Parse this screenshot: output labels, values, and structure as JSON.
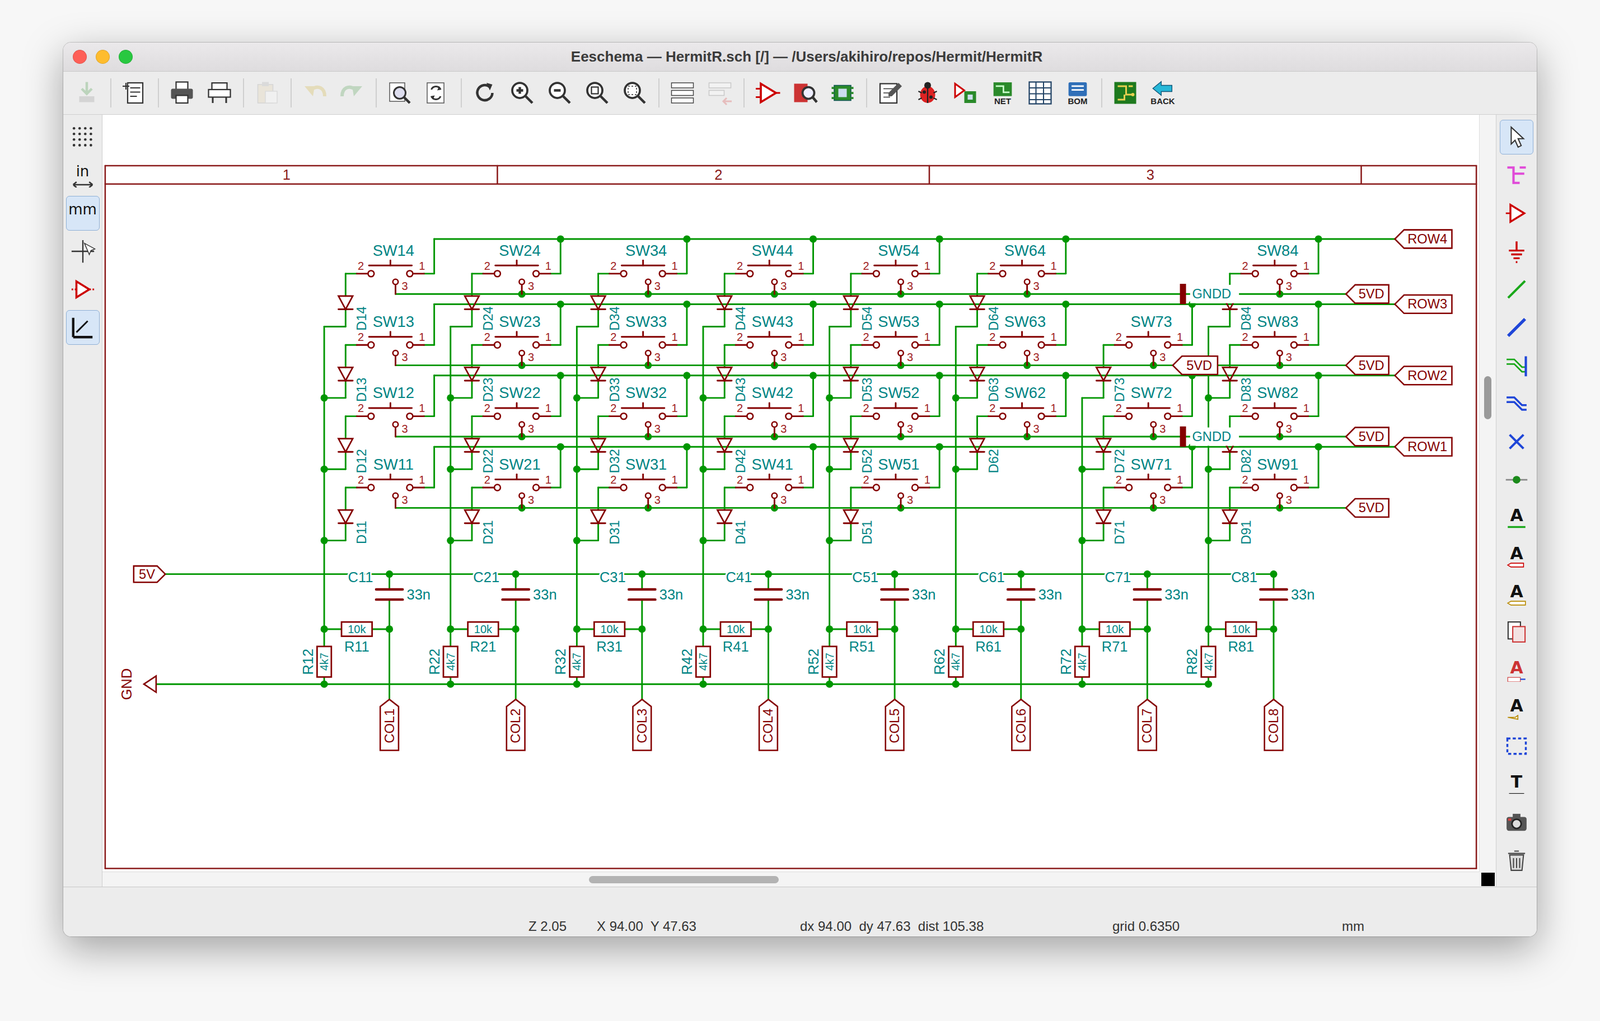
{
  "window": {
    "title": "Eeschema — HermitR.sch [/] — /Users/akihiro/repos/Hermit/HermitR"
  },
  "toolbar": [
    {
      "kind": "save",
      "disabled": true
    },
    {
      "kind": "sep",
      "disabled": false
    },
    {
      "kind": "page",
      "disabled": false
    },
    {
      "kind": "sep",
      "disabled": false
    },
    {
      "kind": "print",
      "disabled": false
    },
    {
      "kind": "plot",
      "disabled": false
    },
    {
      "kind": "sep",
      "disabled": false
    },
    {
      "kind": "paste",
      "disabled": true
    },
    {
      "kind": "sep",
      "disabled": false
    },
    {
      "kind": "undo",
      "disabled": true
    },
    {
      "kind": "redo",
      "disabled": true
    },
    {
      "kind": "sep",
      "disabled": false
    },
    {
      "kind": "find",
      "disabled": false
    },
    {
      "kind": "replace",
      "disabled": false
    },
    {
      "kind": "sep",
      "disabled": false
    },
    {
      "kind": "refresh",
      "disabled": false
    },
    {
      "kind": "zoomin",
      "disabled": false
    },
    {
      "kind": "zoomout",
      "disabled": false
    },
    {
      "kind": "zoomfit",
      "disabled": false
    },
    {
      "kind": "zoomsel",
      "disabled": false
    },
    {
      "kind": "sep",
      "disabled": false
    },
    {
      "kind": "hierarchy",
      "disabled": false
    },
    {
      "kind": "leave",
      "disabled": true
    },
    {
      "kind": "sep",
      "disabled": false
    },
    {
      "kind": "symedit",
      "disabled": false
    },
    {
      "kind": "library",
      "disabled": false
    },
    {
      "kind": "fpedit",
      "disabled": false
    },
    {
      "kind": "sep",
      "disabled": false
    },
    {
      "kind": "annotate",
      "disabled": false
    },
    {
      "kind": "erc",
      "disabled": false
    },
    {
      "kind": "assign",
      "disabled": false
    },
    {
      "kind": "netlist",
      "label": "NET",
      "disabled": false
    },
    {
      "kind": "fields",
      "disabled": false
    },
    {
      "kind": "bom",
      "label": "BOM",
      "disabled": false
    },
    {
      "kind": "sep",
      "disabled": false
    },
    {
      "kind": "pcb",
      "disabled": false
    },
    {
      "kind": "back",
      "label": "BACK",
      "disabled": false
    }
  ],
  "left_toolbar": [
    {
      "kind": "grid",
      "selected": false
    },
    {
      "kind": "inch",
      "label": "in",
      "selected": false
    },
    {
      "kind": "mm",
      "label": "mm",
      "selected": true
    },
    {
      "kind": "cursor",
      "selected": false
    },
    {
      "kind": "pins",
      "selected": false
    },
    {
      "kind": "angle",
      "selected": true
    }
  ],
  "right_toolbar": [
    {
      "kind": "select",
      "selected": true
    },
    {
      "kind": "hiernav",
      "selected": false
    },
    {
      "kind": "symbol",
      "selected": false
    },
    {
      "kind": "power",
      "selected": false
    },
    {
      "kind": "wire",
      "selected": false
    },
    {
      "kind": "bus",
      "selected": false
    },
    {
      "kind": "wireentry",
      "selected": false
    },
    {
      "kind": "busentry",
      "selected": false
    },
    {
      "kind": "noconnect",
      "selected": false
    },
    {
      "kind": "junction",
      "selected": false
    },
    {
      "kind": "label",
      "glyph": "A",
      "selected": false
    },
    {
      "kind": "globallabel",
      "glyph": "A",
      "selected": false
    },
    {
      "kind": "hierlabel",
      "glyph": "A",
      "selected": false
    },
    {
      "kind": "sheet",
      "selected": false
    },
    {
      "kind": "importpin",
      "glyph": "A",
      "selected": false
    },
    {
      "kind": "sheetpin",
      "glyph": "A",
      "selected": false
    },
    {
      "kind": "rect",
      "selected": false
    },
    {
      "kind": "text",
      "glyph": "T",
      "selected": false
    },
    {
      "kind": "image",
      "selected": false
    },
    {
      "kind": "delete",
      "selected": false
    }
  ],
  "sheet": {
    "zones": [
      "1",
      "2",
      "3"
    ]
  },
  "schematic": {
    "power_in": "5V",
    "ground": "GND",
    "pin_numbers": {
      "left": "2",
      "right": "1",
      "common": "3"
    },
    "rows": [
      {
        "label": "ROW4",
        "supply": "5VD",
        "mid": {
          "kind": "ground",
          "text": "GNDD"
        }
      },
      {
        "label": "ROW3",
        "supply": "5VD",
        "mid": {
          "kind": "net",
          "text": "5VD"
        }
      },
      {
        "label": "ROW2",
        "supply": "5VD",
        "mid": {
          "kind": "ground",
          "text": "GNDD"
        }
      },
      {
        "label": "ROW1",
        "supply": "5VD",
        "mid": null
      }
    ],
    "columns": [
      {
        "switches": [
          {
            "ref": "SW14",
            "diode": "D14"
          },
          {
            "ref": "SW13",
            "diode": "D13"
          },
          {
            "ref": "SW12",
            "diode": "D12"
          },
          {
            "ref": "SW11",
            "diode": "D11"
          }
        ],
        "cap": {
          "ref": "C11",
          "value": "33n"
        },
        "r_series": {
          "ref": "R11",
          "value": "10k"
        },
        "r_pull": {
          "ref": "R12",
          "value": "4k7"
        },
        "label": "COL1"
      },
      {
        "switches": [
          {
            "ref": "SW24",
            "diode": "D24"
          },
          {
            "ref": "SW23",
            "diode": "D23"
          },
          {
            "ref": "SW22",
            "diode": "D22"
          },
          {
            "ref": "SW21",
            "diode": "D21"
          }
        ],
        "cap": {
          "ref": "C21",
          "value": "33n"
        },
        "r_series": {
          "ref": "R21",
          "value": "10k"
        },
        "r_pull": {
          "ref": "R22",
          "value": "4k7"
        },
        "label": "COL2"
      },
      {
        "switches": [
          {
            "ref": "SW34",
            "diode": "D34"
          },
          {
            "ref": "SW33",
            "diode": "D33"
          },
          {
            "ref": "SW32",
            "diode": "D32"
          },
          {
            "ref": "SW31",
            "diode": "D31"
          }
        ],
        "cap": {
          "ref": "C31",
          "value": "33n"
        },
        "r_series": {
          "ref": "R31",
          "value": "10k"
        },
        "r_pull": {
          "ref": "R32",
          "value": "4k7"
        },
        "label": "COL3"
      },
      {
        "switches": [
          {
            "ref": "SW44",
            "diode": "D44"
          },
          {
            "ref": "SW43",
            "diode": "D43"
          },
          {
            "ref": "SW42",
            "diode": "D42"
          },
          {
            "ref": "SW41",
            "diode": "D41"
          }
        ],
        "cap": {
          "ref": "C41",
          "value": "33n"
        },
        "r_series": {
          "ref": "R41",
          "value": "10k"
        },
        "r_pull": {
          "ref": "R42",
          "value": "4k7"
        },
        "label": "COL4"
      },
      {
        "switches": [
          {
            "ref": "SW54",
            "diode": "D54"
          },
          {
            "ref": "SW53",
            "diode": "D53"
          },
          {
            "ref": "SW52",
            "diode": "D52"
          },
          {
            "ref": "SW51",
            "diode": "D51"
          }
        ],
        "cap": {
          "ref": "C51",
          "value": "33n"
        },
        "r_series": {
          "ref": "R51",
          "value": "10k"
        },
        "r_pull": {
          "ref": "R52",
          "value": "4k7"
        },
        "label": "COL5"
      },
      {
        "switches": [
          {
            "ref": "SW64",
            "diode": "D64"
          },
          {
            "ref": "SW63",
            "diode": "D63"
          },
          {
            "ref": "SW62",
            "diode": "D62"
          },
          null
        ],
        "cap": {
          "ref": "C61",
          "value": "33n"
        },
        "r_series": {
          "ref": "R61",
          "value": "10k"
        },
        "r_pull": {
          "ref": "R62",
          "value": "4k7"
        },
        "label": "COL6"
      },
      {
        "switches": [
          null,
          {
            "ref": "SW73",
            "diode": "D73"
          },
          {
            "ref": "SW72",
            "diode": "D72"
          },
          {
            "ref": "SW71",
            "diode": "D71"
          }
        ],
        "cap": {
          "ref": "C71",
          "value": "33n"
        },
        "r_series": {
          "ref": "R71",
          "value": "10k"
        },
        "r_pull": {
          "ref": "R72",
          "value": "4k7"
        },
        "label": "COL7"
      },
      {
        "switches": [
          {
            "ref": "SW84",
            "diode": "D84"
          },
          {
            "ref": "SW83",
            "diode": "D83"
          },
          {
            "ref": "SW82",
            "diode": "D82"
          },
          {
            "ref": "SW91",
            "diode": "D91"
          }
        ],
        "cap": {
          "ref": "C81",
          "value": "33n"
        },
        "r_series": {
          "ref": "R81",
          "value": "10k"
        },
        "r_pull": {
          "ref": "R82",
          "value": "4k7"
        },
        "label": "COL8"
      }
    ]
  },
  "status_bar": {
    "zoom": "Z 2.05",
    "cursor": "X 94.00  Y 47.63",
    "delta": "dx 94.00  dy 47.63  dist 105.38",
    "grid": "grid 0.6350",
    "units": "mm"
  }
}
